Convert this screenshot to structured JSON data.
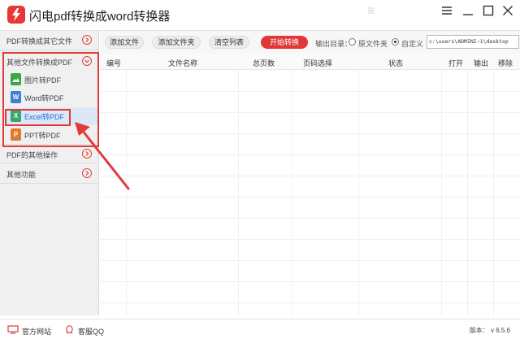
{
  "app": {
    "title": "闪电pdf转换成word转换器",
    "accent": "#e23737"
  },
  "window_controls": [
    "menu-icon",
    "minimize-icon",
    "maximize-icon",
    "close-icon"
  ],
  "sidebar": {
    "sections": [
      {
        "label": "PDF转换成其它文件"
      },
      {
        "label": "其他文件转换成PDF"
      },
      {
        "label": "PDF的其他操作"
      },
      {
        "label": "其他功能"
      }
    ],
    "items": [
      {
        "label": "图片转PDF",
        "icon": "image-icon",
        "color": "#3aa54a",
        "glyph": ""
      },
      {
        "label": "Word转PDF",
        "icon": "word-icon",
        "color": "#3c7fd6",
        "glyph": "W"
      },
      {
        "label": "Excel转PDF",
        "icon": "excel-icon",
        "color": "#3aa56f",
        "glyph": "X"
      },
      {
        "label": "PPT转PDF",
        "icon": "ppt-icon",
        "color": "#e07a2e",
        "glyph": "P"
      }
    ]
  },
  "toolbar": {
    "add_file": "添加文件",
    "add_folder": "添加文件夹",
    "clear_list": "清空列表",
    "start": "开始转换",
    "output_dir_label": "输出目录：",
    "option_original": "原文件夹",
    "option_custom": "自定义",
    "path_value": "c:\\users\\ADMINI~1\\desktop"
  },
  "table": {
    "columns": [
      "编号",
      "文件名称",
      "总页数",
      "页码选择",
      "状态",
      "打开",
      "输出",
      "移除"
    ]
  },
  "statusbar": {
    "website": "官方网站",
    "qq": "客服QQ",
    "version_label": "版本：",
    "version": "v 6.5.6"
  }
}
